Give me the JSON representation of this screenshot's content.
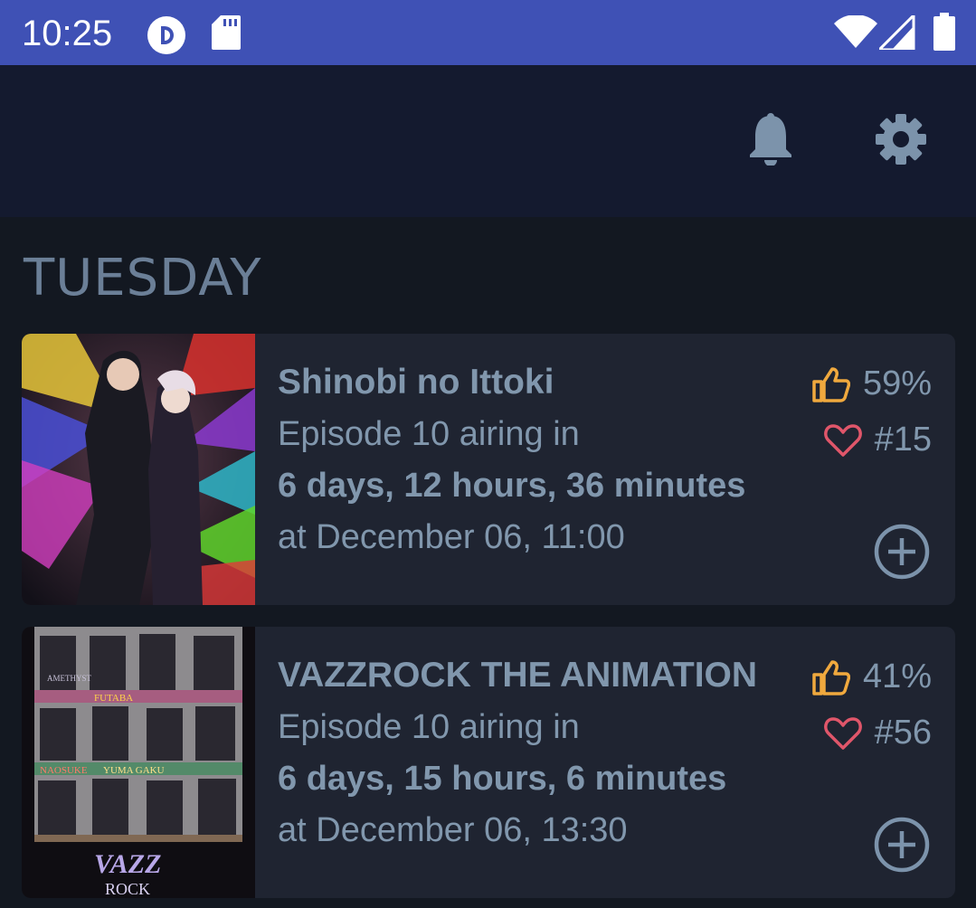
{
  "status_bar": {
    "time": "10:25",
    "icons": [
      "pocket-casts-icon",
      "sd-card-icon",
      "wifi-icon",
      "signal-icon",
      "battery-icon"
    ]
  },
  "app_bar": {
    "icons": [
      "bell-icon",
      "gear-icon"
    ]
  },
  "day": "TUESDAY",
  "cards": [
    {
      "title": "Shinobi no Ittoki",
      "episode": "Episode 10 airing in",
      "countdown": "6 days, 12 hours, 36 minutes",
      "at": "at December 06, 11:00",
      "score": "59%",
      "rank": "#15"
    },
    {
      "title": "VAZZROCK THE ANIMATION",
      "episode": "Episode 10 airing in",
      "countdown": "6 days, 15 hours, 6 minutes",
      "at": "at December 06, 13:30",
      "score": "41%",
      "rank": "#56"
    }
  ],
  "colors": {
    "status_bar": "#3f51b5",
    "app_bar": "#141a2f",
    "background": "#131821",
    "card": "#1f2431",
    "text": "#8197ad",
    "thumb": "#f0a93e",
    "heart": "#e0566a"
  }
}
